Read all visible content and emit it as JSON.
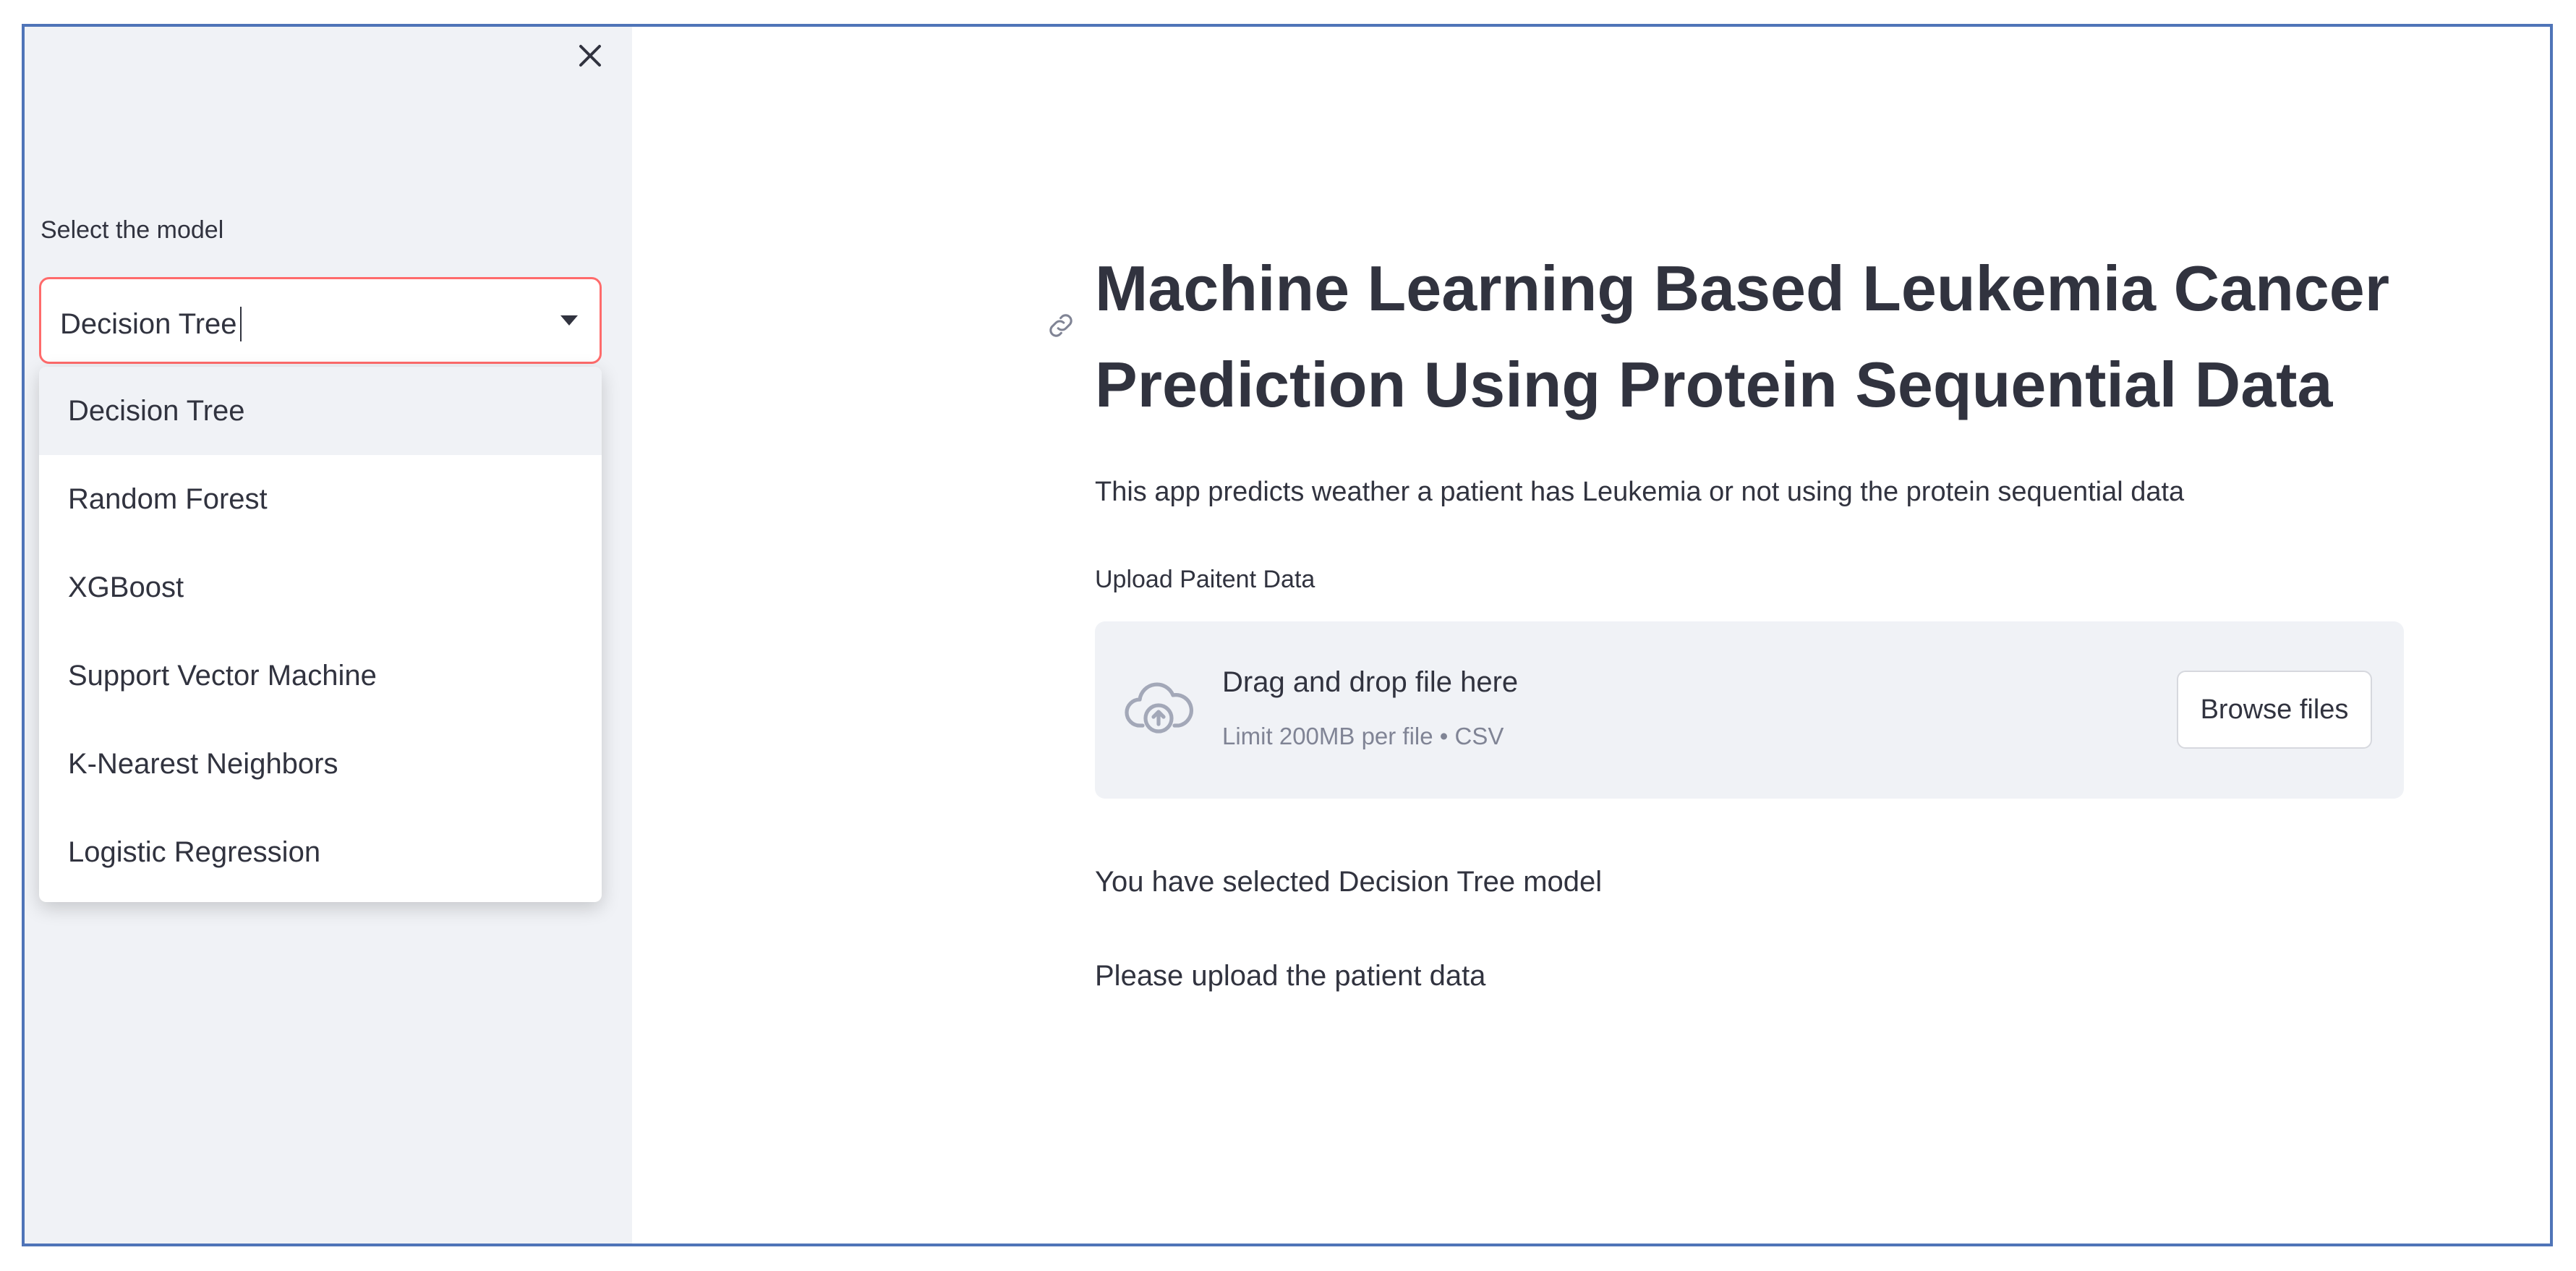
{
  "sidebar": {
    "close_icon": "close-icon",
    "select_label": "Select the model",
    "select_value": "Decision Tree",
    "options": [
      "Decision Tree",
      "Random Forest",
      "XGBoost",
      "Support Vector Machine",
      "K-Nearest Neighbors",
      "Logistic Regression"
    ],
    "selected_index": 0
  },
  "main": {
    "title": "Machine Learning Based Leukemia Cancer Prediction Using Protein Sequential Data",
    "subtitle": "This app predicts weather a patient has Leukemia or not using the protein sequential data",
    "upload_label": "Upload Paitent Data",
    "dropzone": {
      "title": "Drag and drop file here",
      "limit": "Limit 200MB per file • CSV",
      "browse_label": "Browse files"
    },
    "selected_message": "You have selected Decision Tree model",
    "upload_prompt": "Please upload the patient data"
  },
  "colors": {
    "sidebar_bg": "#f0f2f6",
    "select_border_focus": "#ff6b6b",
    "frame_border": "#4f74b8",
    "text": "#31333f",
    "muted_text": "#808495"
  }
}
